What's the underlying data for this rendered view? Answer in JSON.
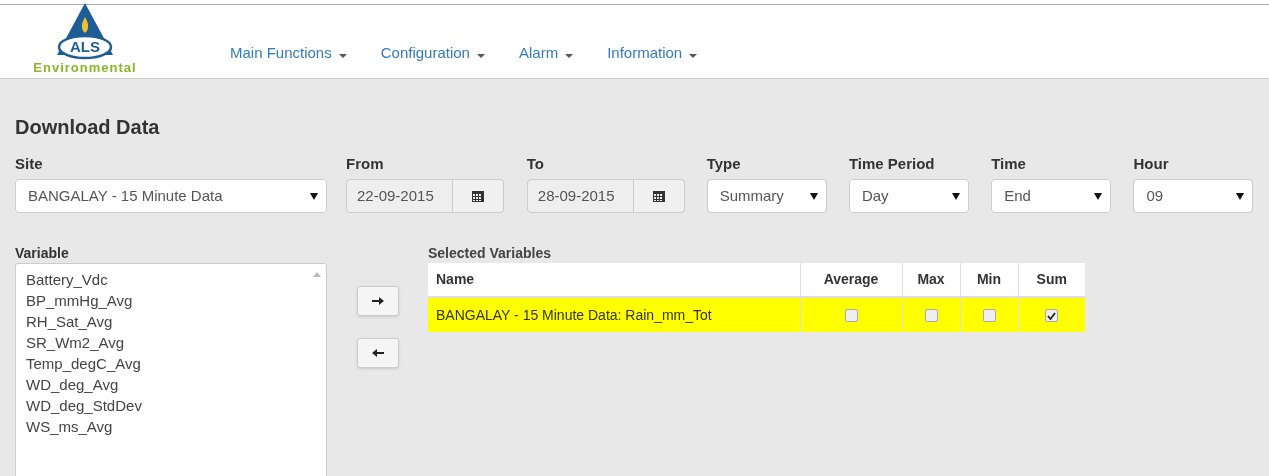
{
  "logo": {
    "mark": "ALS",
    "name": "Environmental"
  },
  "nav": [
    {
      "label": "Main Functions"
    },
    {
      "label": "Configuration"
    },
    {
      "label": "Alarm"
    },
    {
      "label": "Information"
    }
  ],
  "title": "Download Data",
  "filters": [
    {
      "kind": "select",
      "label": "Site",
      "value": "BANGALAY - 15 Minute Data"
    },
    {
      "kind": "date",
      "label": "From",
      "value": "22-09-2015"
    },
    {
      "kind": "date",
      "label": "To",
      "value": "28-09-2015"
    },
    {
      "kind": "select",
      "label": "Type",
      "value": "Summary"
    },
    {
      "kind": "select",
      "label": "Time Period",
      "value": "Day"
    },
    {
      "kind": "select",
      "label": "Time",
      "value": "End"
    },
    {
      "kind": "select",
      "label": "Hour",
      "value": "09"
    }
  ],
  "variable": {
    "label": "Variable",
    "items": [
      "Battery_Vdc",
      "BP_mmHg_Avg",
      "RH_Sat_Avg",
      "SR_Wm2_Avg",
      "Temp_degC_Avg",
      "WD_deg_Avg",
      "WD_deg_StdDev",
      "WS_ms_Avg"
    ]
  },
  "selected_variables": {
    "label": "Selected Variables",
    "columns": [
      "Name",
      "Average",
      "Max",
      "Min",
      "Sum"
    ],
    "rows": [
      {
        "name": "BANGALAY - 15 Minute Data: Rain_mm_Tot",
        "selected": true,
        "checks": [
          {
            "checked": false
          },
          {
            "checked": false
          },
          {
            "checked": false
          },
          {
            "checked": true
          }
        ]
      }
    ]
  }
}
